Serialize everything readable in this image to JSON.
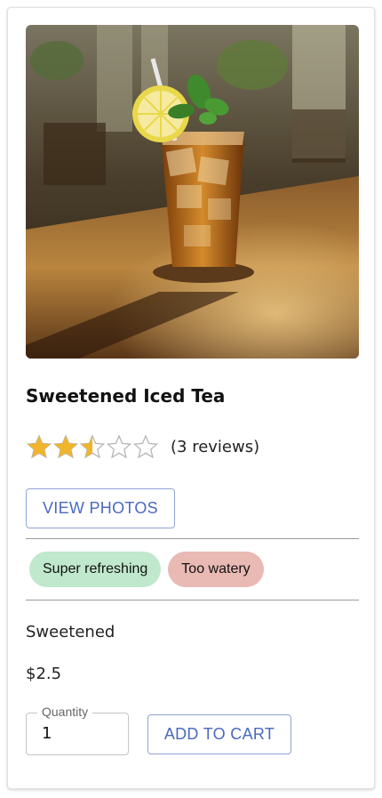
{
  "product": {
    "name": "Sweetened Iced Tea",
    "image_icon": "iced-tea-photo",
    "rating": 2.5,
    "rating_max": 5,
    "reviews_text": "(3 reviews)",
    "view_photos_label": "VIEW PHOTOS",
    "tags": [
      {
        "label": "Super refreshing",
        "sentiment": "positive"
      },
      {
        "label": "Too watery",
        "sentiment": "negative"
      }
    ],
    "variant": "Sweetened",
    "price": "$2.5",
    "quantity": {
      "label": "Quantity",
      "value": "1"
    },
    "add_to_cart_label": "ADD TO CART"
  },
  "colors": {
    "star_filled": "#f0b52d",
    "star_empty": "#b5b5b5",
    "button_text": "#4a69c0",
    "button_border": "#8fa3d6",
    "chip_positive": "#bfe8cc",
    "chip_negative": "#e9b9b3"
  }
}
